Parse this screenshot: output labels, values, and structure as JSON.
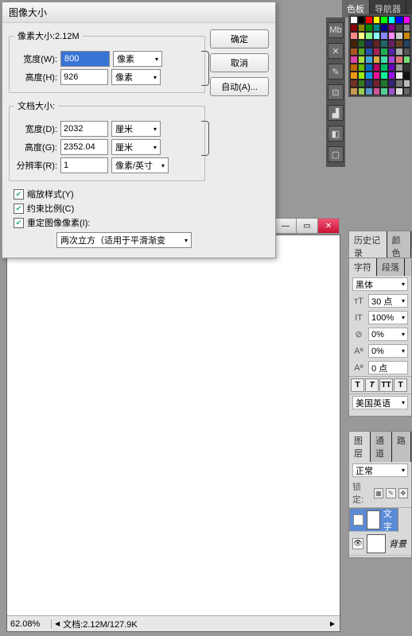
{
  "dialog": {
    "title": "图像大小",
    "pixel_dim_label": "像素大小:2.12M",
    "doc_dim_label": "文档大小:",
    "width_label": "宽度(W):",
    "height_label": "高度(H):",
    "width_d_label": "宽度(D):",
    "height_g_label": "高度(G):",
    "res_label": "分辨率(R):",
    "px_width": "800",
    "px_height": "926",
    "doc_width": "2032",
    "doc_height": "2352.04",
    "resolution": "1",
    "unit_px": "像素",
    "unit_cm": "厘米",
    "unit_ppi": "像素/英寸",
    "scale_styles": "缩放样式(Y)",
    "constrain": "约束比例(C)",
    "resample": "重定图像像素(I):",
    "interp": "两次立方（适用于平滑渐变",
    "ok": "确定",
    "cancel": "取消",
    "auto": "自动(A)..."
  },
  "status": {
    "zoom": "62.08%",
    "doc": "文档:2.12M/127.9K"
  },
  "right_tabs": {
    "swatch": "色板",
    "nav": "导航器"
  },
  "hist_tabs": {
    "history": "历史记录",
    "color": "颜色"
  },
  "char": {
    "tab1": "字符",
    "tab2": "段落",
    "font": "黑体",
    "size": "30 点",
    "leading": "100%",
    "tracking": "0%",
    "vscale": "0%",
    "baseline": "0 点",
    "btn_t": "T",
    "btn_tt": "TT",
    "lang": "美国英语"
  },
  "layers": {
    "tab1": "图层",
    "tab2": "通道",
    "tab3": "路",
    "blend": "正常",
    "lock_label": "锁定:",
    "layer_text": "文字",
    "layer_bg": "背景"
  },
  "swatch_colors": [
    [
      "#fff",
      "#000",
      "#f00",
      "#ff0",
      "#0f0",
      "#0ff",
      "#00f",
      "#f0f"
    ],
    [
      "#800",
      "#880",
      "#080",
      "#088",
      "#008",
      "#808",
      "#444",
      "#888"
    ],
    [
      "#f88",
      "#ff8",
      "#8f8",
      "#8ff",
      "#88f",
      "#f8f",
      "#ccc",
      "#c80"
    ],
    [
      "#420",
      "#262",
      "#226",
      "#622",
      "#266",
      "#626",
      "#642",
      "#246"
    ],
    [
      "#a52",
      "#5a2",
      "#25a",
      "#a25",
      "#2a5",
      "#52a",
      "#aaa",
      "#555"
    ],
    [
      "#d4a",
      "#ad4",
      "#4ad",
      "#da4",
      "#4da",
      "#a4d",
      "#d77",
      "#7d7"
    ],
    [
      "#b60",
      "#6b0",
      "#06b",
      "#b06",
      "#0b6",
      "#60b",
      "#999",
      "#333"
    ],
    [
      "#e91",
      "#9e1",
      "#19e",
      "#e19",
      "#1e9",
      "#91e",
      "#eee",
      "#111"
    ],
    [
      "#732",
      "#372",
      "#237",
      "#723",
      "#273",
      "#327",
      "#777",
      "#bbb"
    ],
    [
      "#c95",
      "#9c5",
      "#59c",
      "#c59",
      "#5c9",
      "#95c",
      "#ddd",
      "#666"
    ]
  ]
}
